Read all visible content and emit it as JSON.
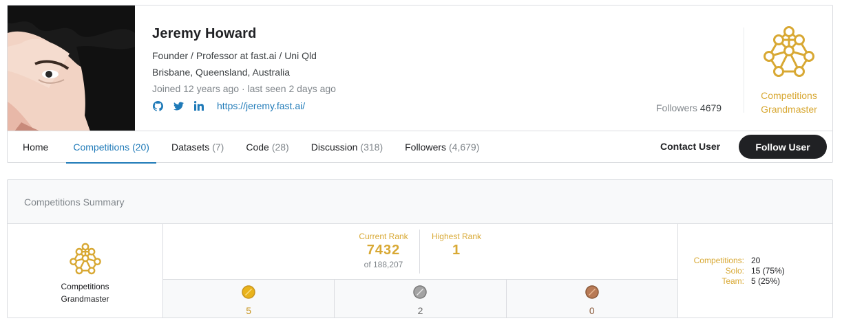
{
  "profile": {
    "name": "Jeremy Howard",
    "bio": "Founder / Professor at fast.ai / Uni Qld",
    "location": "Brisbane, Queensland, Australia",
    "joined": "Joined 12 years ago · last seen 2 days ago",
    "homepage": "https://jeremy.fast.ai/",
    "followers_label": "Followers",
    "followers_count": "4679",
    "tier": "Competitions Grandmaster",
    "social_icons": [
      "github-icon",
      "twitter-icon",
      "linkedin-icon"
    ]
  },
  "tabs": [
    {
      "label": "Home",
      "count": ""
    },
    {
      "label": "Competitions",
      "count": "(20)"
    },
    {
      "label": "Datasets",
      "count": "(7)"
    },
    {
      "label": "Code",
      "count": "(28)"
    },
    {
      "label": "Discussion",
      "count": "(318)"
    },
    {
      "label": "Followers",
      "count": "(4,679)"
    }
  ],
  "active_tab": "Competitions",
  "actions": {
    "contact": "Contact User",
    "follow": "Follow User"
  },
  "summary": {
    "title": "Competitions Summary",
    "tier_line1": "Competitions",
    "tier_line2": "Grandmaster",
    "current_rank_label": "Current Rank",
    "current_rank": "7432",
    "current_rank_of": "of 188,207",
    "highest_rank_label": "Highest Rank",
    "highest_rank": "1",
    "medals": {
      "gold": "5",
      "silver": "2",
      "bronze": "0"
    },
    "stats": [
      {
        "key": "Competitions:",
        "value": "20"
      },
      {
        "key": "Solo:",
        "value": "15 (75%)"
      },
      {
        "key": "Team:",
        "value": "5 (25%)"
      }
    ]
  },
  "colors": {
    "accent": "#1f7ab8",
    "gold": "#d8a833",
    "dark": "#202124"
  }
}
